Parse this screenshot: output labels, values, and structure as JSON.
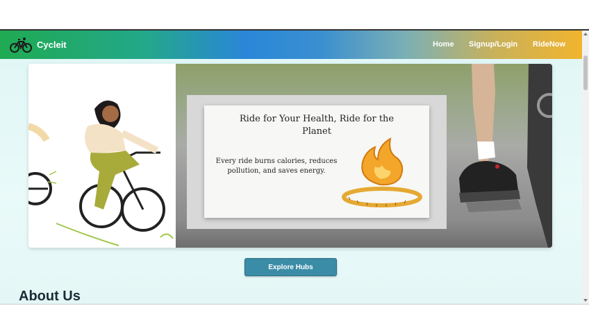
{
  "navbar": {
    "brand": "Cycleit",
    "links": [
      {
        "label": "Home"
      },
      {
        "label": "Signup/Login"
      },
      {
        "label": "RideNow"
      }
    ]
  },
  "hero": {
    "card_title": "Ride for Your Health, Ride for the Planet",
    "card_body": "Every ride burns calories, reduces pollution, and saves energy."
  },
  "cta": {
    "label": "Explore Hubs"
  },
  "section": {
    "title": "About Us"
  },
  "colors": {
    "nav_gradient_start": "#1faa52",
    "nav_gradient_mid": "#2a86d8",
    "nav_gradient_end": "#f1b42e",
    "button": "#3b8ca7",
    "page_bg": "#dff6f5"
  },
  "icons": {
    "logo": "bicycle-icon",
    "card_art": "flame-measuring-tape-icon"
  }
}
